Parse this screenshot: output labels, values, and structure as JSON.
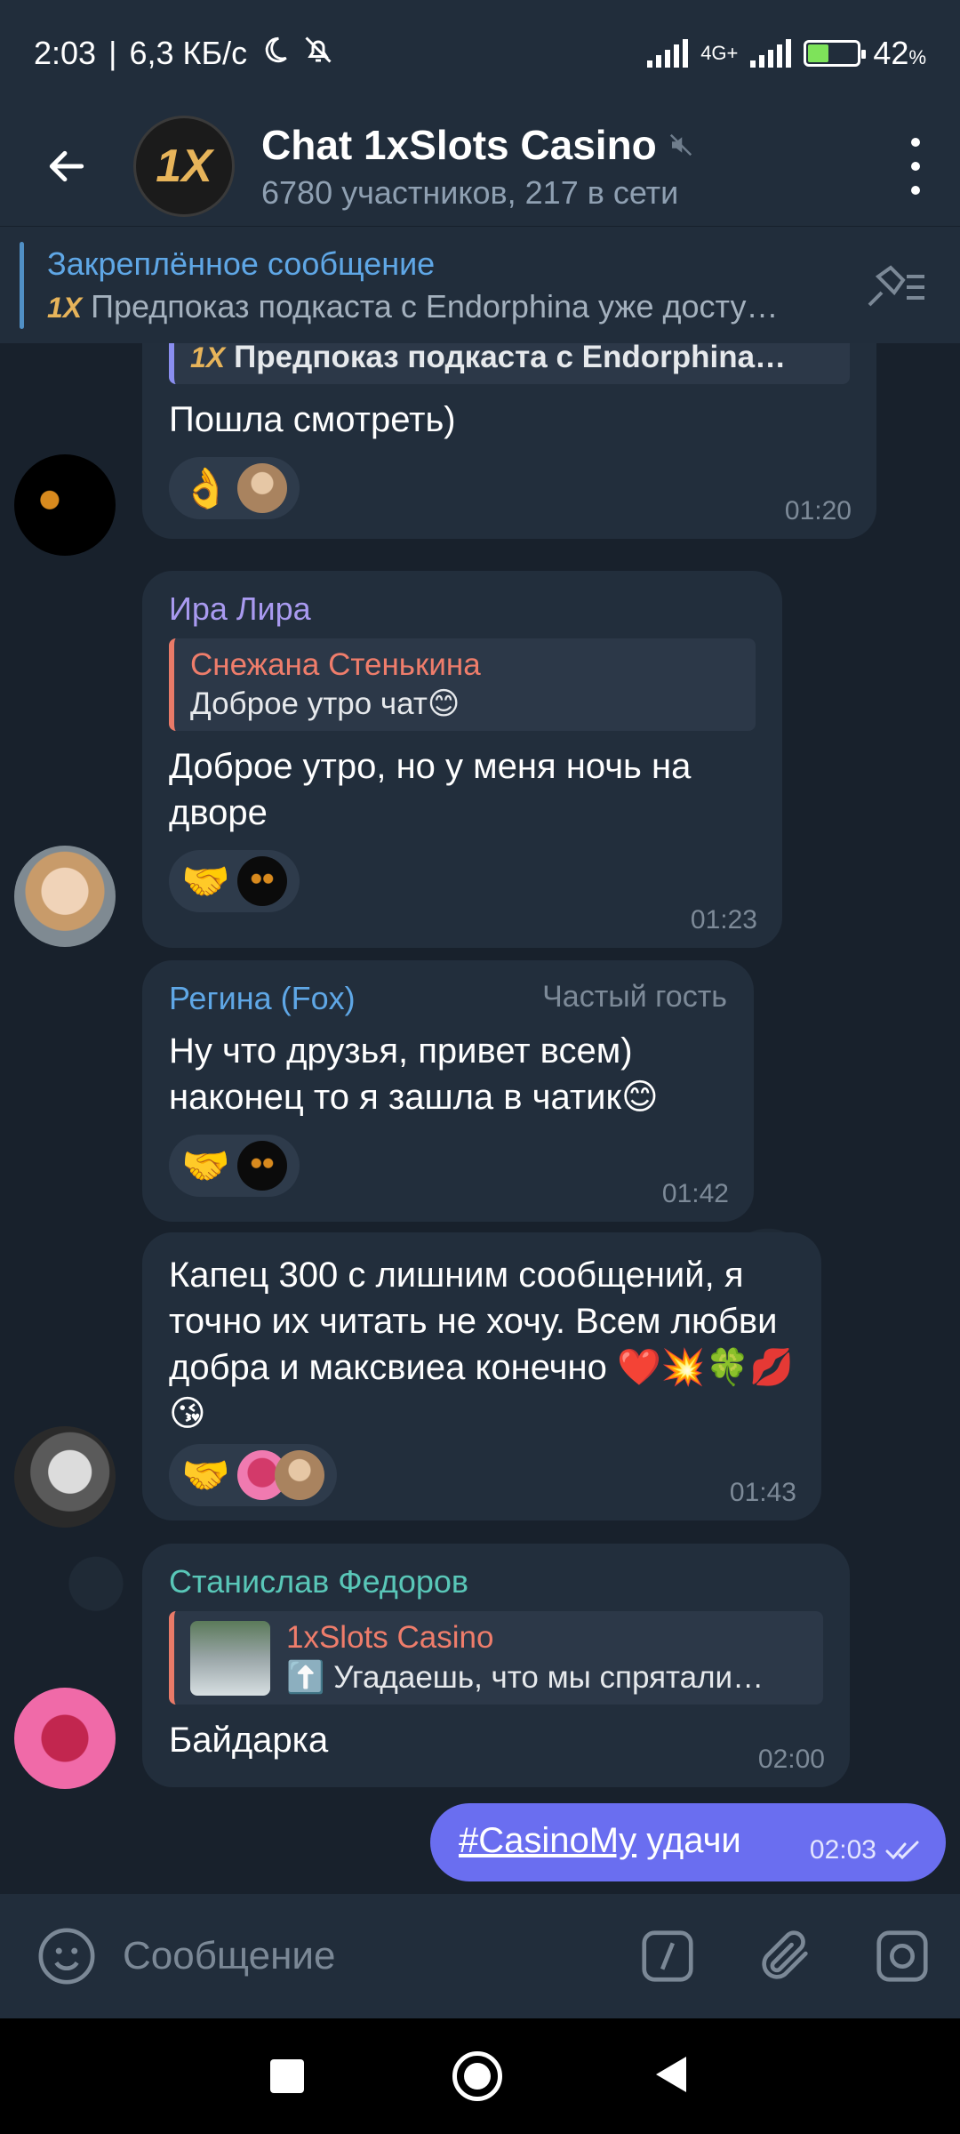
{
  "status_bar": {
    "time": "2:03",
    "speed": "6,3 КБ/с",
    "network": "4G+",
    "battery": "42",
    "battery_unit": "%",
    "battery_level": 0.42
  },
  "header": {
    "title": "Chat 1xSlots Casino",
    "subtitle": "6780 участников, 217 в сети",
    "logo_text": "1X"
  },
  "pinned": {
    "title": "Закреплённое сообщение",
    "message": "Предпоказ подкаста с Endorphina уже досту…"
  },
  "messages": [
    {
      "reply_text": "Предпоказ подкаста с Endorphina…",
      "text": "Пошла смотреть)",
      "reaction": "👌",
      "time": "01:20"
    },
    {
      "sender": "Ира Лира",
      "reply_name": "Снежана Стенькина",
      "reply_text": "Доброе утро чат😊",
      "text": "Доброе утро, но у меня ночь на дворе",
      "reaction": "🤝",
      "time": "01:23"
    },
    {
      "sender": "Регина (Fox)",
      "badge": "Частый гость",
      "text": "Ну что друзья, привет всем) наконец то я зашла в чатик😊",
      "reaction": "🤝",
      "time": "01:42"
    },
    {
      "text": "Капец 300 с лишним сообщений, я точно их читать не хочу. Всем любви добра и максвиеа конечно ❤️💥🍀💋😘",
      "reaction": "🤝",
      "time": "01:43"
    },
    {
      "sender": "Станислав Федоров",
      "reply_name": "1xSlots Casino",
      "reply_text": "⬆️ Угадаешь, что мы спрятали…",
      "text": "Байдарка",
      "time": "02:00"
    }
  ],
  "outgoing": {
    "hashtag": "#CasinoMy",
    "text": " удачи",
    "time": "02:03"
  },
  "input": {
    "placeholder": "Сообщение"
  },
  "colors": {
    "background": "#18212c",
    "bubble_in": "#222e3c",
    "bubble_out": "#6a6ef0",
    "accent": "#5fa7e6"
  }
}
